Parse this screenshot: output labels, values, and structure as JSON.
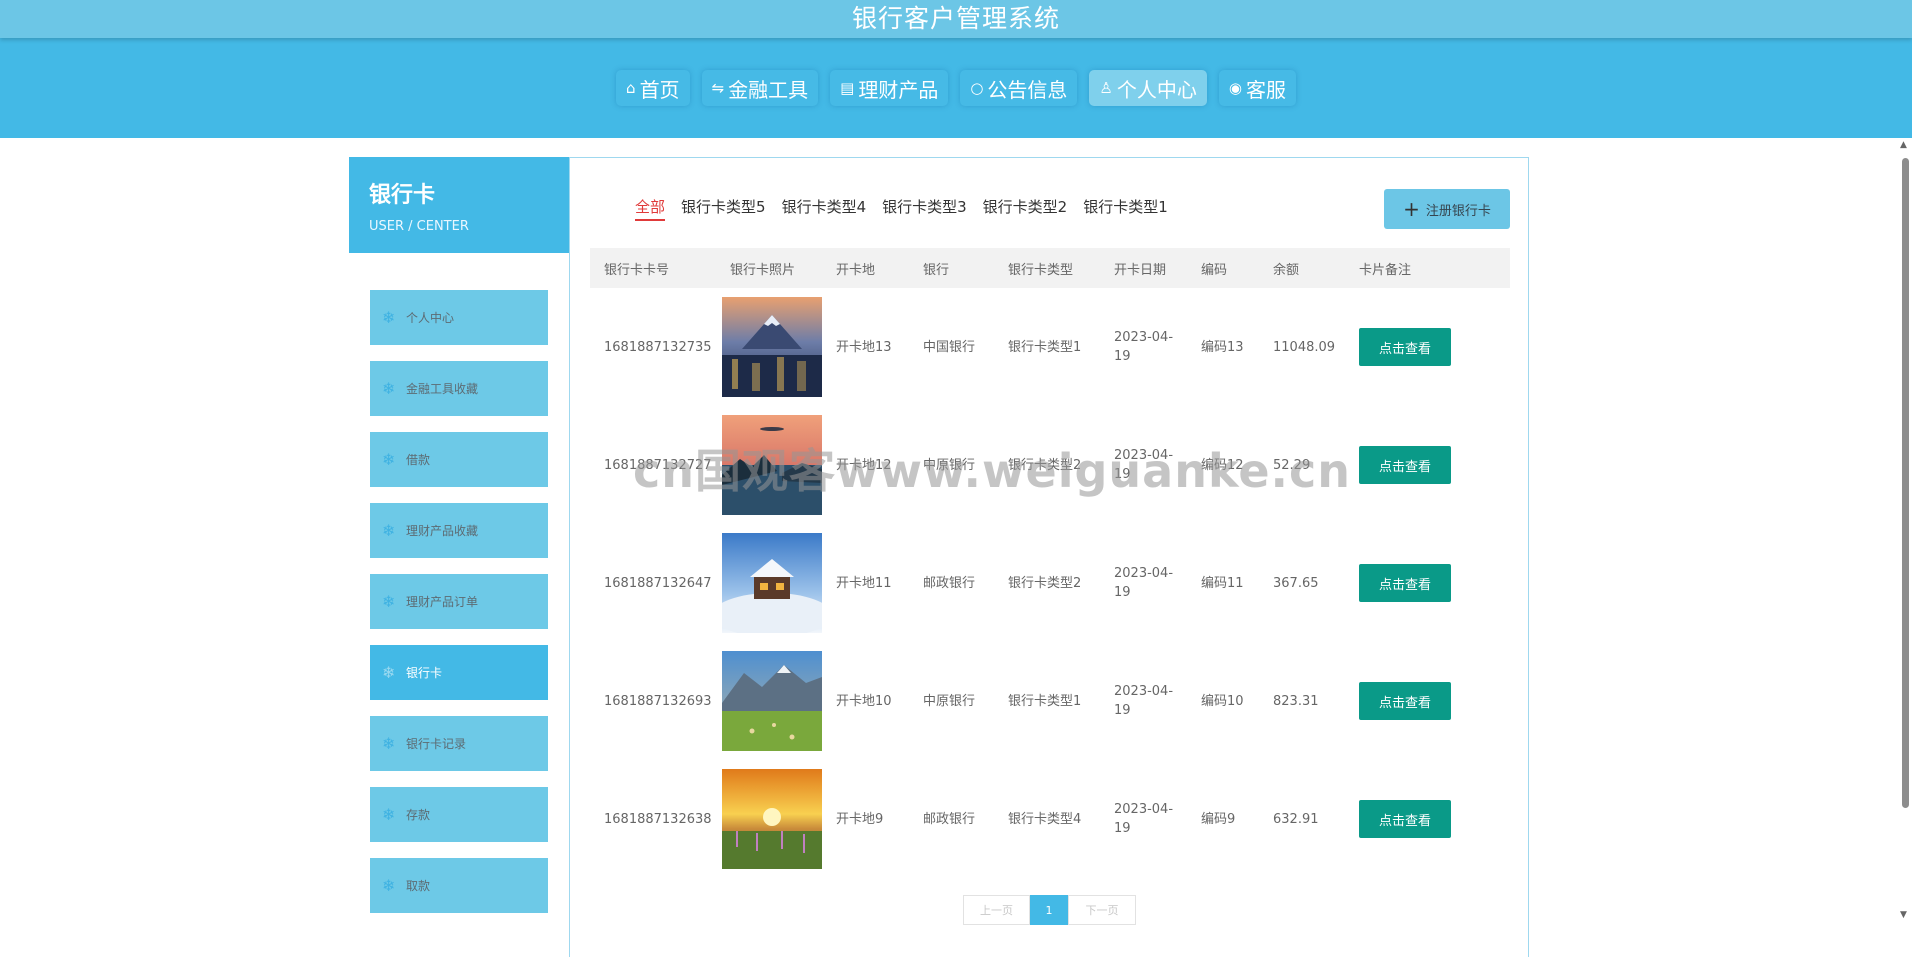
{
  "site": {
    "title": "银行客户管理系统"
  },
  "nav": [
    {
      "label": "首页",
      "icon": "home-icon",
      "glyph": "⌂"
    },
    {
      "label": "金融工具",
      "icon": "exchange-icon",
      "glyph": "⇋"
    },
    {
      "label": "理财产品",
      "icon": "document-icon",
      "glyph": "▤"
    },
    {
      "label": "公告信息",
      "icon": "circle-icon",
      "glyph": "○"
    },
    {
      "label": "个人中心",
      "icon": "user-icon",
      "glyph": "♙",
      "active": true
    },
    {
      "label": "客服",
      "icon": "service-icon",
      "glyph": "◉"
    }
  ],
  "sidebar": {
    "title": "银行卡",
    "subtitle": "USER / CENTER",
    "items": [
      {
        "label": "个人中心"
      },
      {
        "label": "金融工具收藏"
      },
      {
        "label": "借款"
      },
      {
        "label": "理财产品收藏"
      },
      {
        "label": "理财产品订单"
      },
      {
        "label": "银行卡",
        "active": true
      },
      {
        "label": "银行卡记录"
      },
      {
        "label": "存款"
      },
      {
        "label": "取款"
      }
    ],
    "icon_glyph": "❄"
  },
  "filters": {
    "items": [
      "全部",
      "银行卡类型5",
      "银行卡类型4",
      "银行卡类型3",
      "银行卡类型2",
      "银行卡类型1"
    ],
    "active_index": 0
  },
  "register_button": {
    "label": "注册银行卡",
    "icon": "plus-icon"
  },
  "table": {
    "headers": [
      "银行卡卡号",
      "银行卡照片",
      "开卡地",
      "银行",
      "银行卡类型",
      "开卡日期",
      "编码",
      "余额",
      "卡片备注"
    ],
    "action_label": "点击查看",
    "rows": [
      {
        "card_no": "1681887132735",
        "image": "photo-mountain-city",
        "location": "开卡地13",
        "bank": "中国银行",
        "type": "银行卡类型1",
        "date": "2023-04-19",
        "code": "编码13",
        "balance": "11048.09"
      },
      {
        "card_no": "1681887132727",
        "image": "photo-sunset-lake",
        "location": "开卡地12",
        "bank": "中原银行",
        "type": "银行卡类型2",
        "date": "2023-04-19",
        "code": "编码12",
        "balance": "52.29"
      },
      {
        "card_no": "1681887132647",
        "image": "photo-snow-cabin",
        "location": "开卡地11",
        "bank": "邮政银行",
        "type": "银行卡类型2",
        "date": "2023-04-19",
        "code": "编码11",
        "balance": "367.65"
      },
      {
        "card_no": "1681887132693",
        "image": "photo-mountain-meadow",
        "location": "开卡地10",
        "bank": "中原银行",
        "type": "银行卡类型1",
        "date": "2023-04-19",
        "code": "编码10",
        "balance": "823.31"
      },
      {
        "card_no": "1681887132638",
        "image": "photo-sunrise-field",
        "location": "开卡地9",
        "bank": "邮政银行",
        "type": "银行卡类型4",
        "date": "2023-04-19",
        "code": "编码9",
        "balance": "632.91"
      }
    ]
  },
  "pagination": {
    "prev": "上一页",
    "current": "1",
    "next": "下一页"
  },
  "watermark": "cn国观客www.weiguanke.cn",
  "colors": {
    "primary": "#43b9e6",
    "topbar": "#6cc6e6",
    "menu": "#6dc9e7",
    "action": "#0a9a88",
    "filter_active": "#e03a3a"
  }
}
